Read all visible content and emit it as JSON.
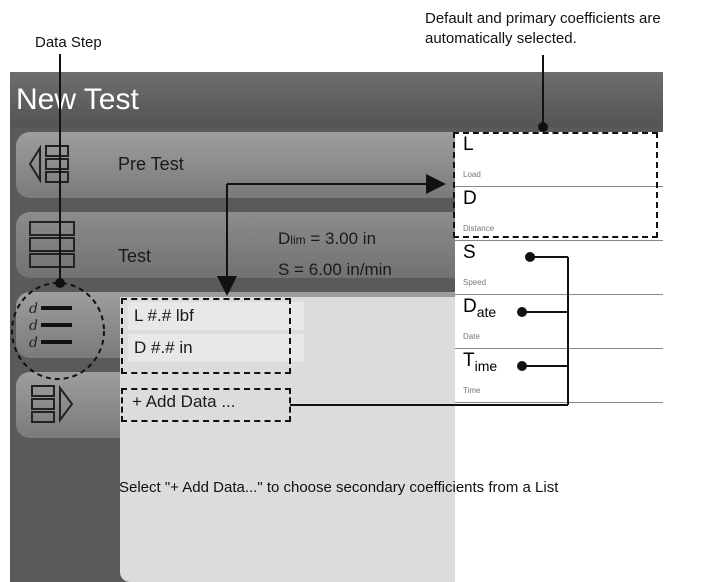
{
  "callouts": {
    "data_step": "Data Step",
    "default_coeffs": "Default and primary coefficients are automatically selected.",
    "select_add": "Select \"+ Add Data...\" to choose secondary coefficients from a List"
  },
  "app": {
    "title": "New Test"
  },
  "steps": {
    "pretest": "Pre Test",
    "test": "Test",
    "test_values": {
      "dlim_symbol": "D",
      "dlim_sub": "lim",
      "dlim_value": " = 3.00 in",
      "speed": "S = 6.00 in/min"
    },
    "data_icon_letter": "d"
  },
  "data_items": {
    "load": "L  #.# lbf",
    "distance": "D  #.# in",
    "add": "+ Add Data ..."
  },
  "coefficients": [
    {
      "symbol": "L",
      "sub": "",
      "name": "Load"
    },
    {
      "symbol": "D",
      "sub": "",
      "name": "Distance"
    },
    {
      "symbol": "S",
      "sub": "",
      "name": "Speed"
    },
    {
      "symbol": "D",
      "sub": "ate",
      "name": "Date"
    },
    {
      "symbol": "T",
      "sub": "ime",
      "name": "Time"
    }
  ]
}
